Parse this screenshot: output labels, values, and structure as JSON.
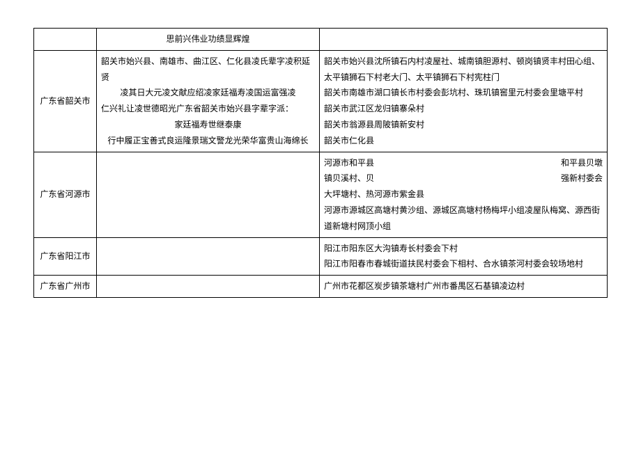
{
  "rows": {
    "r0": {
      "region": "",
      "mid": "思前兴伟业功绩显辉煌",
      "right": ""
    },
    "r1": {
      "region": "广东省韶关市",
      "mid_line1": "韶关市始兴县、南雄市、曲江区、仁化县凌氏辈字凌积延贤",
      "mid_line2": "凌其日大元凌文献应绍凌家廷福寿凌国运富强凌",
      "mid_line3": "仁兴礼让凌世德昭光广东省韶关市始兴县字辈字派：",
      "mid_line4": "家廷福寿世继泰康",
      "mid_line5": "行中履正宝善式良运隆景瑞文警龙光荣华富贵山海绵长",
      "right_line1": "韶关市始兴县沈所镇石内村凌屋社、城南镇胆源村、顿岗镇贤丰村田心组、太平镇狮石下村老大门、太平镇狮石下村宪柱门",
      "right_line2": "韶关市南雄市湖口镇长市村委会彭坑村、珠玑镇窖里元村委会里塘平村",
      "right_line3": "韶关市武江区龙归镇寨朵村",
      "right_line4": "韶关市翁源县周陂镇新安村",
      "right_line5": "韶关市仁化县"
    },
    "r2": {
      "region": "广东省河源市",
      "mid": "",
      "right_a1": "河源市和平县",
      "right_a2": "和平县贝墩",
      "right_b1": "镇贝溪村、贝",
      "right_b2": "强新村委会",
      "right_c": "大坪塘村、热河源市紫金县",
      "right_d": "河源市源城区高塘村黄沙组、源城区高塘村杨梅坪小组凌屋队梅窝、源西街道新塘村网顶小组"
    },
    "r3": {
      "region": "广东省阳江市",
      "mid": "",
      "right_line1": "阳江市阳东区大沟镇寿长村委会下村",
      "right_line2": "阳江市阳春市春城街道扶民村委会下相村、合水镇茶河村委会较场地村"
    },
    "r4": {
      "region": "广东省广州市",
      "mid": "",
      "right": "广州市花都区炭步镇茶塘村广州市番禺区石基镇凌边村"
    }
  }
}
